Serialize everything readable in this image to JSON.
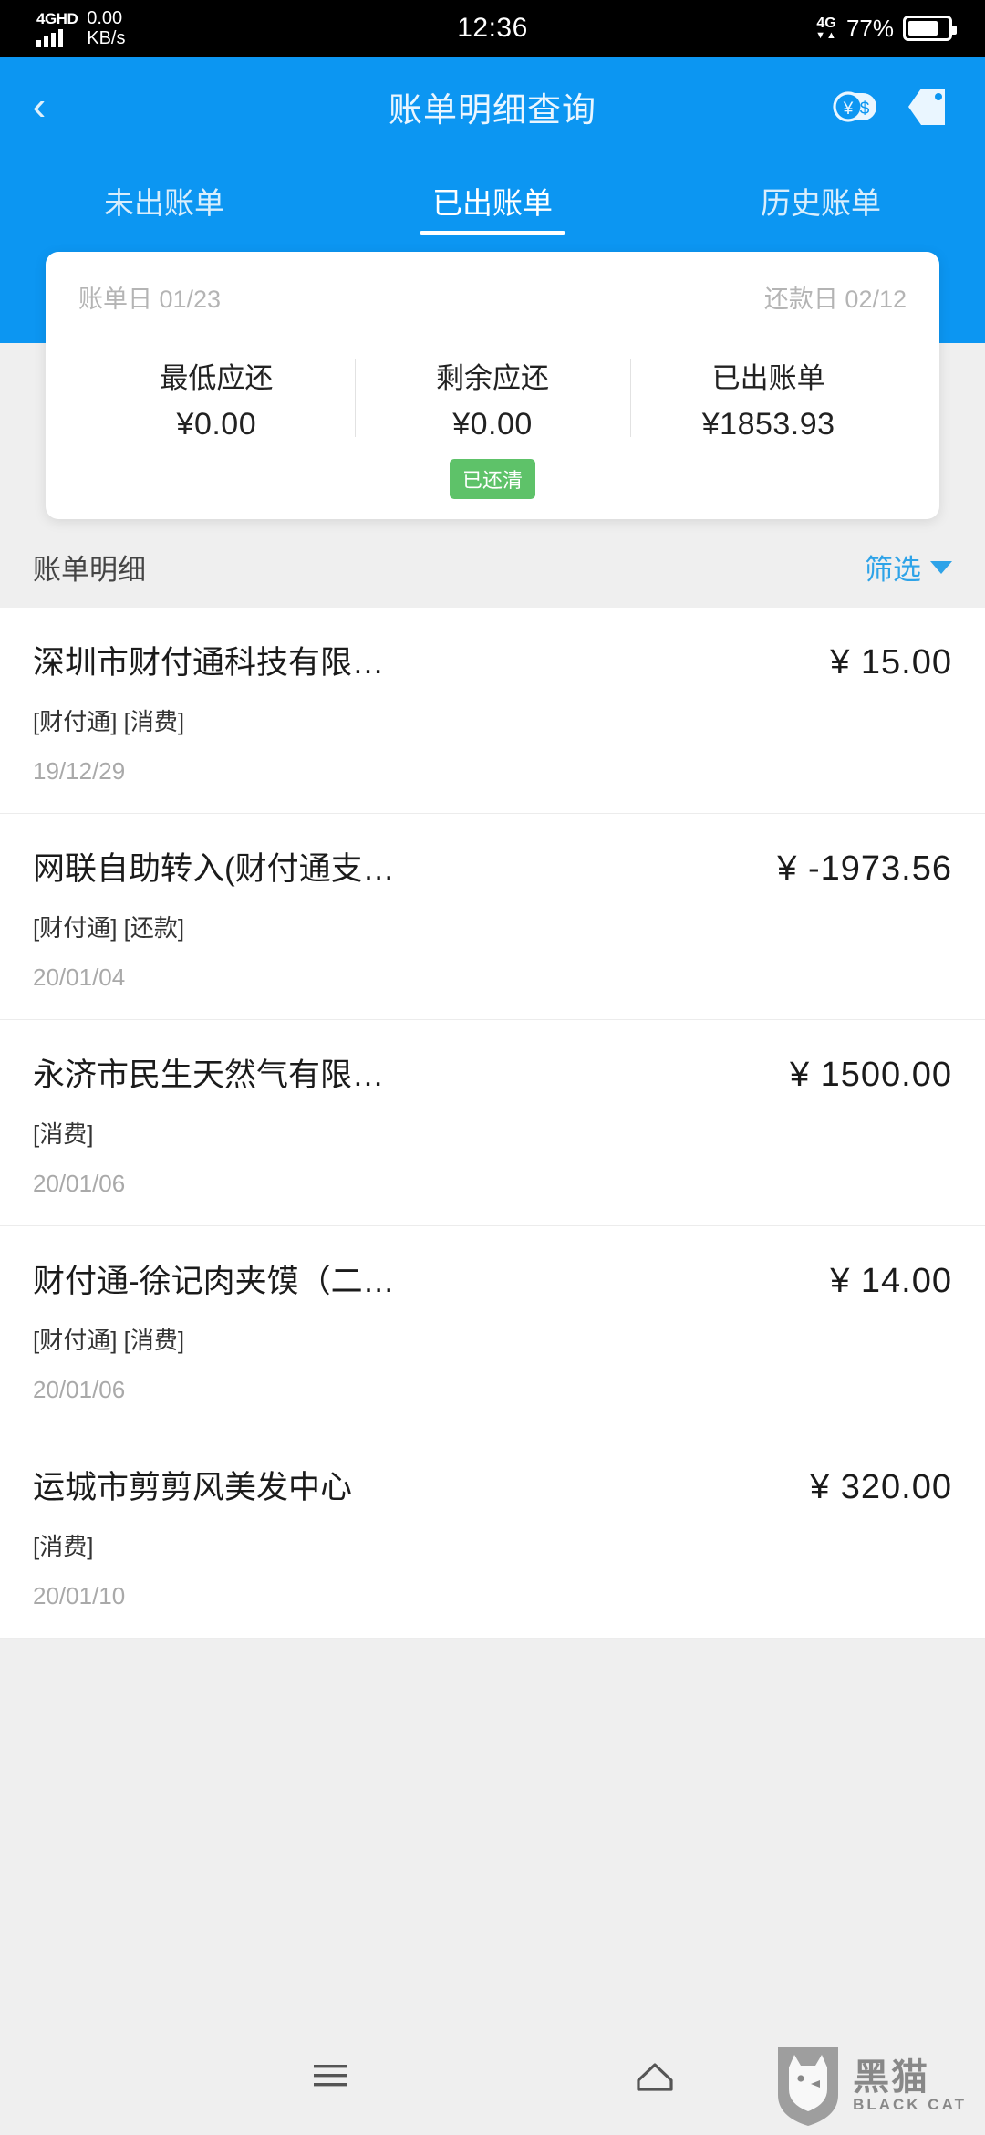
{
  "status_bar": {
    "network_type": "4GHD",
    "net_speed_value": "0.00",
    "net_speed_unit": "KB/s",
    "time": "12:36",
    "mobile_network": "4G",
    "battery_percent": "77%",
    "battery_level": 77
  },
  "header": {
    "back_icon": "chevron-left-icon",
    "title": "账单明细查询",
    "currency_icon": "currency-exchange-icon",
    "tag_icon": "tag-icon",
    "background_color": "#0c96f2"
  },
  "tabs": [
    {
      "label": "未出账单",
      "active": false
    },
    {
      "label": "已出账单",
      "active": true
    },
    {
      "label": "历史账单",
      "active": false
    }
  ],
  "summary_card": {
    "bill_date_label": "账单日 01/23",
    "repay_date_label": "还款日 02/12",
    "columns": [
      {
        "label": "最低应还",
        "value": "¥0.00"
      },
      {
        "label": "剩余应还",
        "value": "¥0.00"
      },
      {
        "label": "已出账单",
        "value": "¥1853.93"
      }
    ],
    "status_badge": "已还清",
    "status_badge_color": "#5ec269"
  },
  "list_header": {
    "title": "账单明细",
    "filter_label": "筛选",
    "filter_icon": "chevron-down-icon",
    "filter_color": "#2ea3e8"
  },
  "transactions": [
    {
      "name": "深圳市财付通科技有限…",
      "amount": "¥ 15.00",
      "tags": "[财付通] [消费]",
      "date": "19/12/29"
    },
    {
      "name": "网联自助转入(财付通支…",
      "amount": "¥ -1973.56",
      "tags": "[财付通] [还款]",
      "date": "20/01/04"
    },
    {
      "name": "永济市民生天然气有限…",
      "amount": "¥ 1500.00",
      "tags": "[消费]",
      "date": "20/01/06"
    },
    {
      "name": "财付通-徐记肉夹馍（二…",
      "amount": "¥ 14.00",
      "tags": "[财付通] [消费]",
      "date": "20/01/06"
    },
    {
      "name": "运城市剪剪风美发中心",
      "amount": "¥ 320.00",
      "tags": "[消费]",
      "date": "20/01/10"
    }
  ],
  "bottom_nav": {
    "menu_icon": "menu-icon",
    "home_icon": "home-icon"
  },
  "watermark": {
    "cat_icon": "black-cat-logo-icon",
    "name_cn": "黑猫",
    "name_en": "BLACK CAT"
  }
}
